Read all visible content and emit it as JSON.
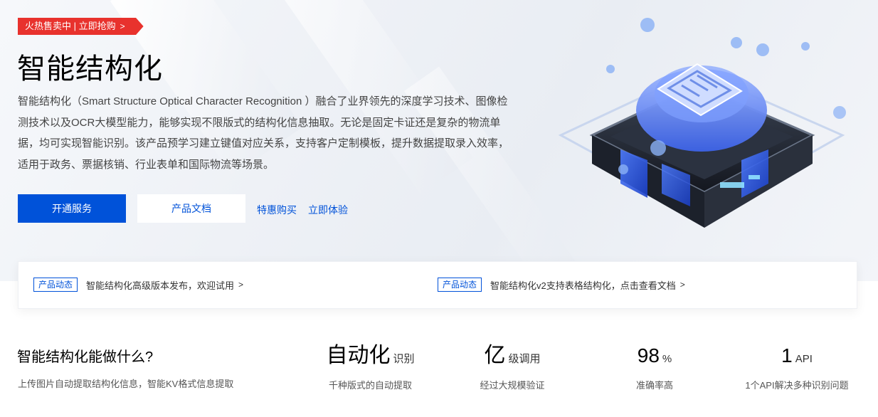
{
  "hero": {
    "promo_tag": "火热售卖中 | 立即抢购",
    "promo_tag_chevron": ">",
    "title": "智能结构化",
    "description": "智能结构化（Smart Structure Optical Character Recognition ）融合了业界领先的深度学习技术、图像检测技术以及OCR大模型能力，能够实现不限版式的结构化信息抽取。无论是固定卡证还是复杂的物流单据，均可实现智能识别。该产品预学习建立键值对应关系，支持客户定制模板，提升数据提取录入效率，适用于政务、票据核销、行业表单和国际物流等场景。",
    "buttons": {
      "primary": "开通服务",
      "secondary": "产品文档"
    },
    "links": {
      "discount": "特惠购买",
      "trial": "立即体验"
    },
    "illustration_icon": "document-structure-chip-icon"
  },
  "news": [
    {
      "badge": "产品动态",
      "text": "智能结构化高级版本发布，欢迎试用",
      "chevron": ">"
    },
    {
      "badge": "产品动态",
      "text": "智能结构化v2支持表格结构化，点击查看文档",
      "chevron": ">"
    }
  ],
  "intro": {
    "title": "智能结构化能做什么?",
    "subtitle": "上传图片自动提取结构化信息，智能KV格式信息提取"
  },
  "stats": [
    {
      "value": "自动化",
      "unit": "识别",
      "label": "千种版式的自动提取"
    },
    {
      "value": "亿",
      "unit": "级调用",
      "label": "经过大规模验证"
    },
    {
      "value": "98",
      "unit": "%",
      "label": "准确率高"
    },
    {
      "value": "1",
      "unit": "API",
      "label": "1个API解决多种识别问题"
    }
  ],
  "colors": {
    "primary": "#0052d9",
    "promo": "#e8322d"
  }
}
